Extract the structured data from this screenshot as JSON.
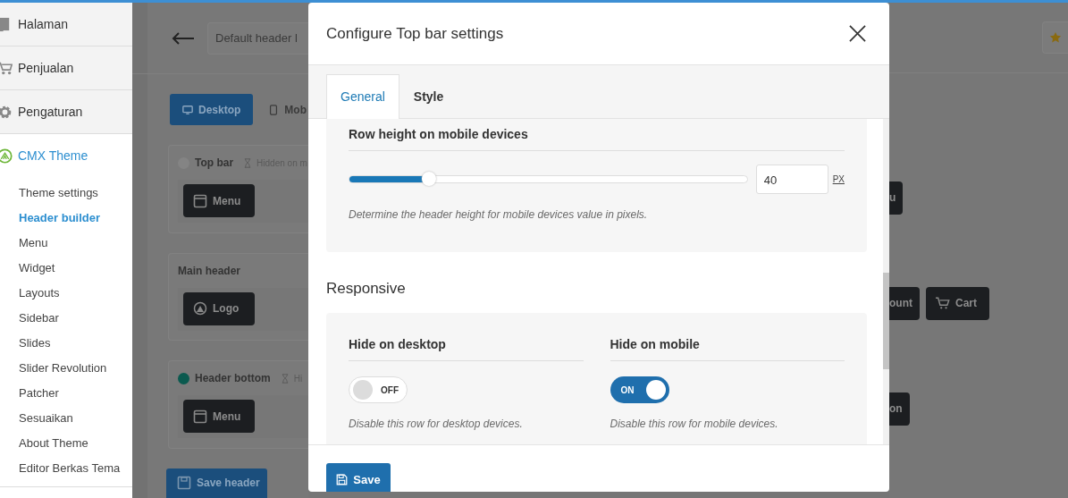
{
  "sidebar": {
    "items": [
      {
        "label": "Halaman",
        "selected": false
      },
      {
        "label": "Penjualan",
        "selected": false
      },
      {
        "label": "Pengaturan",
        "selected": false
      },
      {
        "label": "CMX Theme",
        "selected": true
      }
    ],
    "subitems": [
      {
        "label": "Theme settings",
        "selected": false
      },
      {
        "label": "Header builder",
        "selected": true
      },
      {
        "label": "Menu",
        "selected": false
      },
      {
        "label": "Widget",
        "selected": false
      },
      {
        "label": "Layouts",
        "selected": false
      },
      {
        "label": "Sidebar",
        "selected": false
      },
      {
        "label": "Slides",
        "selected": false
      },
      {
        "label": "Slider Revolution",
        "selected": false
      },
      {
        "label": "Patcher",
        "selected": false
      },
      {
        "label": "Sesuaikan",
        "selected": false
      },
      {
        "label": "About Theme",
        "selected": false
      },
      {
        "label": "Editor Berkas Tema",
        "selected": false
      }
    ]
  },
  "builder": {
    "name_field": "Default header l",
    "device_tabs": [
      {
        "label": "Desktop",
        "selected": true
      },
      {
        "label": "Mob",
        "selected": false
      }
    ],
    "rows": [
      {
        "title": "Top bar",
        "color": "#848484",
        "note": "Hidden on m",
        "left": [
          {
            "label": "Menu"
          }
        ],
        "right": [
          {
            "label": "u"
          }
        ]
      },
      {
        "title": "Main header",
        "left": [
          {
            "label": "Logo"
          }
        ],
        "right": [
          {
            "label": "ount"
          },
          {
            "label": "Cart"
          }
        ]
      },
      {
        "title": "Header bottom",
        "color": "#0b5a4f",
        "note": "Hi",
        "left": [
          {
            "label": "Menu"
          }
        ],
        "right": [
          {
            "label": "on"
          }
        ]
      }
    ],
    "save_button": "Save header"
  },
  "modal": {
    "title": "Configure Top bar settings",
    "tabs": [
      {
        "label": "General",
        "selected": true
      },
      {
        "label": "Style",
        "selected": false
      }
    ],
    "row_height": {
      "label": "Row height on mobile devices",
      "level": 0.2,
      "value": "40",
      "unit": "PX",
      "hint": "Determine the header height for mobile devices value in pixels."
    },
    "responsive": {
      "heading": "Responsive",
      "toggles": [
        {
          "label": "Hide on desktop",
          "on": false,
          "state_text": "OFF",
          "hint": "Disable this row for desktop devices."
        },
        {
          "label": "Hide on mobile",
          "on": true,
          "state_text": "ON",
          "hint": "Disable this row for mobile devices."
        }
      ]
    },
    "save_button": "Save"
  }
}
